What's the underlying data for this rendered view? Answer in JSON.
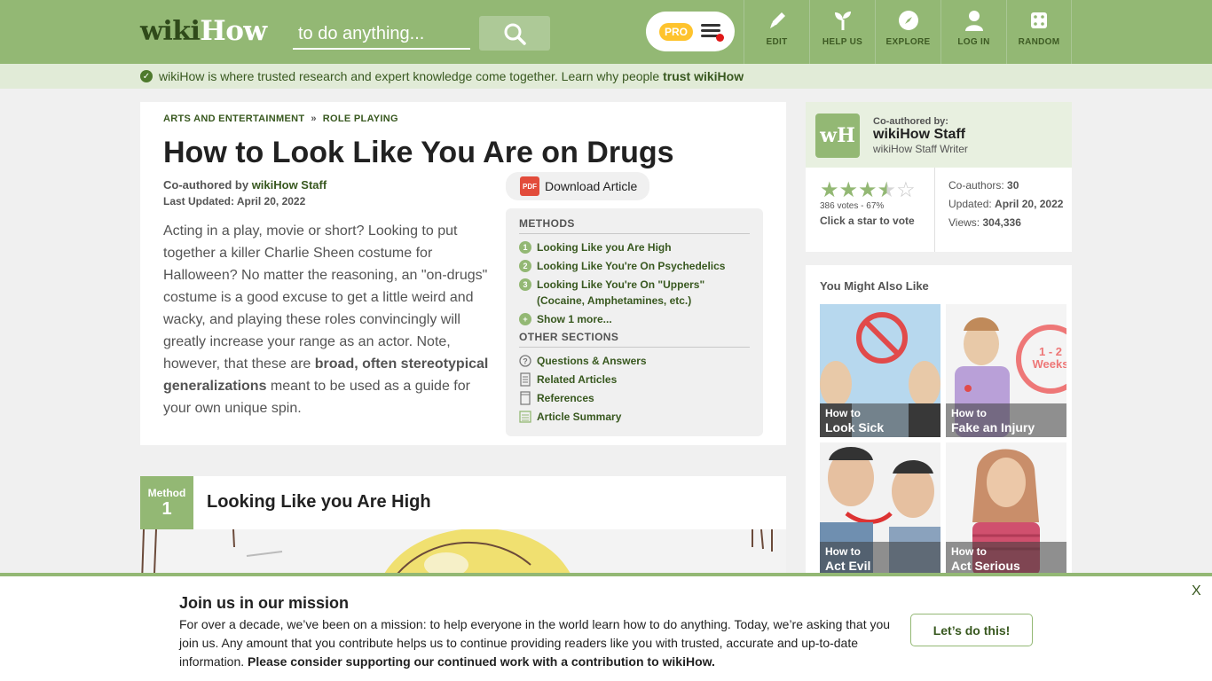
{
  "header": {
    "logo_wiki": "wiki",
    "logo_how": "How",
    "search_placeholder": "to do anything...",
    "pro_label": "PRO",
    "nav": [
      {
        "label": "EDIT",
        "icon": "pencil-icon"
      },
      {
        "label": "HELP US",
        "icon": "sprout-icon"
      },
      {
        "label": "EXPLORE",
        "icon": "compass-icon"
      },
      {
        "label": "LOG IN",
        "icon": "user-icon"
      },
      {
        "label": "RANDOM",
        "icon": "dice-icon"
      }
    ]
  },
  "trust_bar": {
    "text": "wikiHow is where trusted research and expert knowledge come together. Learn why people",
    "link": "trust wikiHow"
  },
  "article": {
    "breadcrumbs": [
      "ARTS AND ENTERTAINMENT",
      "ROLE PLAYING"
    ],
    "breadcrumb_sep": "»",
    "title": "How to Look Like You Are on Drugs",
    "coauthored_label": "Co-authored by",
    "coauthor": "wikiHow Staff",
    "last_updated": "Last Updated: April 20, 2022",
    "download_label": "Download Article",
    "pdf_label": "PDF",
    "intro_part1": "Acting in a play, movie or short? Looking to put together a killer Charlie Sheen costume for Halloween? No matter the reasoning, an \"on-drugs\" costume is a good excuse to get a little weird and wacky, and playing these roles convincingly will greatly increase your range as an actor. Note, however, that these are ",
    "intro_bold": "broad, often stereotypical generalizations",
    "intro_part2": " meant to be used as a guide for your own unique spin."
  },
  "toc": {
    "methods_heading": "METHODS",
    "methods": [
      {
        "num": "1",
        "label": "Looking Like you Are High"
      },
      {
        "num": "2",
        "label": "Looking Like You're On Psychedelics"
      },
      {
        "num": "3",
        "label": "Looking Like You're On \"Uppers\" (Cocaine, Amphetamines, etc.)"
      }
    ],
    "show_more": "Show 1 more...",
    "show_more_icon": "+",
    "other_heading": "OTHER SECTIONS",
    "other": [
      {
        "label": "Questions & Answers",
        "icon": "question-icon"
      },
      {
        "label": "Related Articles",
        "icon": "document-icon"
      },
      {
        "label": "References",
        "icon": "page-icon"
      },
      {
        "label": "Article Summary",
        "icon": "summary-icon"
      }
    ]
  },
  "method1": {
    "badge_label": "Method",
    "badge_num": "1",
    "title": "Looking Like you Are High"
  },
  "author_card": {
    "logo_text": "wH",
    "coauthored_by": "Co-authored by:",
    "name": "wikiHow Staff",
    "role": "wikiHow Staff Writer",
    "rating": 3.35,
    "votes": "386 votes - 67%",
    "vote_cta": "Click a star to vote",
    "coauthors_label": "Co-authors:",
    "coauthors": "30",
    "updated_label": "Updated:",
    "updated": "April 20, 2022",
    "views_label": "Views:",
    "views": "304,336"
  },
  "you_might_also_like": {
    "heading": "You Might Also Like",
    "items": [
      {
        "prefix": "How to",
        "title": "Look Sick"
      },
      {
        "prefix": "How to",
        "title": "Fake an Injury"
      },
      {
        "prefix": "How to",
        "title": "Act Evil"
      },
      {
        "prefix": "How to",
        "title": "Act Serious"
      }
    ]
  },
  "banner": {
    "title": "Join us in our mission",
    "text": "For over a decade, we’ve been on a mission: to help everyone in the world learn how to do anything. Today, we’re asking that you join us. Any amount that you contribute helps us to continue providing readers like you with trusted, accurate and up-to-date information. ",
    "text_bold": "Please consider supporting our continued work with a contribution to wikiHow.",
    "button": "Let’s do this!",
    "close": "X"
  },
  "colors": {
    "brand_green": "#93b874",
    "dark_green": "#38581f",
    "star": "#93b874"
  }
}
